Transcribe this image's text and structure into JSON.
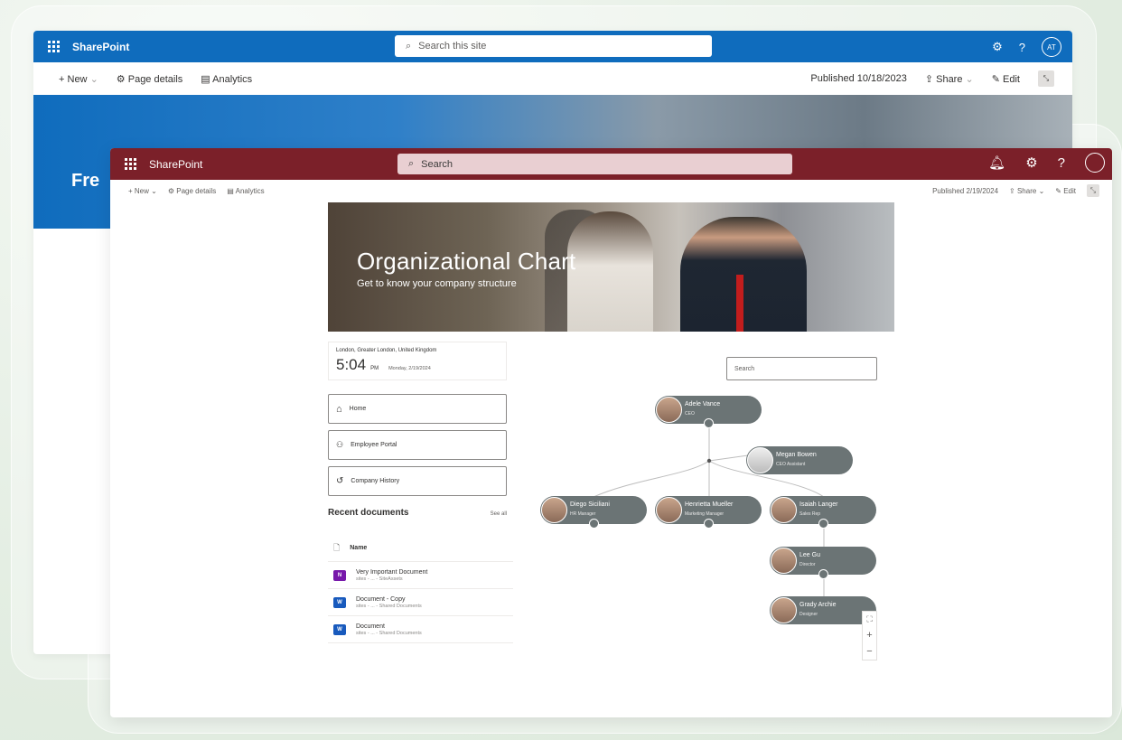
{
  "back_window": {
    "app_name": "SharePoint",
    "search_placeholder": "Search this site",
    "avatar_initials": "AT",
    "help_glyph": "?",
    "cmd": {
      "new": "New",
      "page_details": "Page details",
      "analytics": "Analytics",
      "published": "Published 10/18/2023",
      "share": "Share",
      "edit": "Edit"
    },
    "hero_title": "Fre",
    "colors": {
      "suite_bar": "#0f6cbd"
    }
  },
  "front_window": {
    "app_name": "SharePoint",
    "search_placeholder": "Search",
    "help_glyph": "?",
    "cmd": {
      "new": "New",
      "page_details": "Page details",
      "analytics": "Analytics",
      "published": "Published 2/19/2024",
      "share": "Share",
      "edit": "Edit"
    },
    "colors": {
      "suite_bar": "#7b2029",
      "node": "#6b7475"
    },
    "banner": {
      "title": "Organizational Chart",
      "subtitle": "Get to know your company structure"
    },
    "clock": {
      "location": "London, Greater London, United Kingdom",
      "time": "5:04",
      "ampm": "PM",
      "date": "Monday, 2/19/2024"
    },
    "nav": [
      {
        "label": "Home",
        "icon": "home-icon"
      },
      {
        "label": "Employee Portal",
        "icon": "people-icon"
      },
      {
        "label": "Company History",
        "icon": "history-icon"
      }
    ],
    "recent": {
      "title": "Recent documents",
      "see_all": "See all",
      "column": "Name",
      "docs": [
        {
          "name": "Very Important Document",
          "path": "sites - ... - SiteAssets",
          "type": "onenote",
          "badge": "N"
        },
        {
          "name": "Document - Copy",
          "path": "sites - ... - Shared Documents",
          "type": "word",
          "badge": "W"
        },
        {
          "name": "Document",
          "path": "sites - ... - Shared Documents",
          "type": "word",
          "badge": "W"
        }
      ]
    },
    "org": {
      "search_placeholder": "Search",
      "people": [
        {
          "name": "Adele Vance",
          "title": "CEO"
        },
        {
          "name": "Megan Bowen",
          "title": "CEO Assistant"
        },
        {
          "name": "Diego Siciliani",
          "title": "HR Manager"
        },
        {
          "name": "Henrietta Mueller",
          "title": "Marketing Manager"
        },
        {
          "name": "Isaiah Langer",
          "title": "Sales Rep"
        },
        {
          "name": "Lee Gu",
          "title": "Director"
        },
        {
          "name": "Grady Archie",
          "title": "Designer"
        }
      ],
      "zoom_in": "+",
      "zoom_out": "−"
    }
  }
}
